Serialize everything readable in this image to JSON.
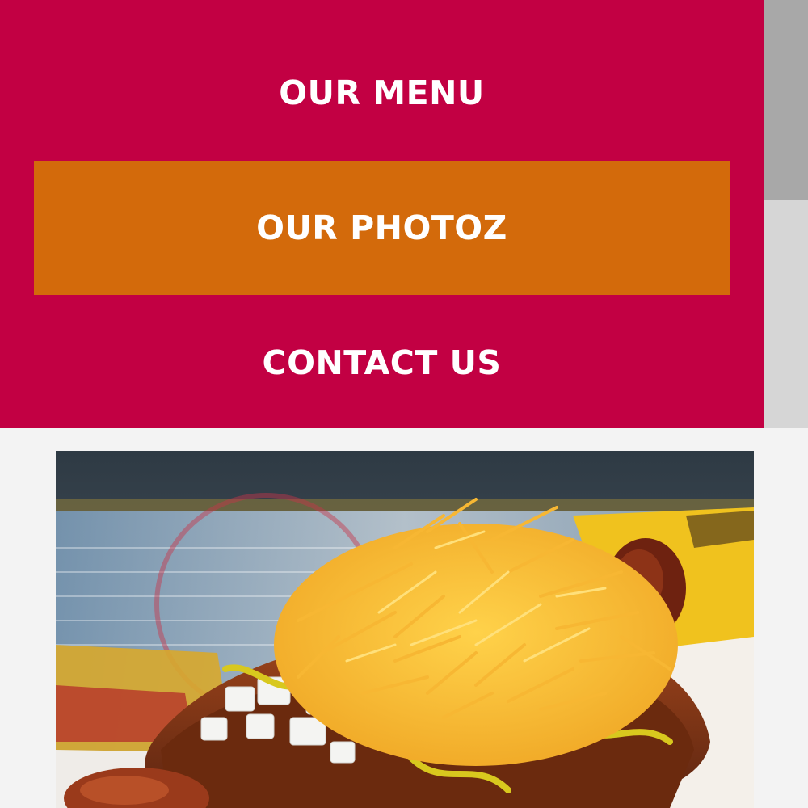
{
  "nav": {
    "items": [
      {
        "label": "OUR MENU",
        "active": false
      },
      {
        "label": "OUR PHOTOZ",
        "active": true
      },
      {
        "label": "CONTACT US",
        "active": false
      }
    ],
    "colors": {
      "panel_background": "#c20043",
      "active_background": "#d36a0b",
      "text": "#ffffff"
    }
  },
  "scrollbar": {
    "position_fraction": 0.0
  },
  "photo": {
    "subject": "hot-dog-with-chili-onions-mustard-and-shredded-cheese"
  }
}
